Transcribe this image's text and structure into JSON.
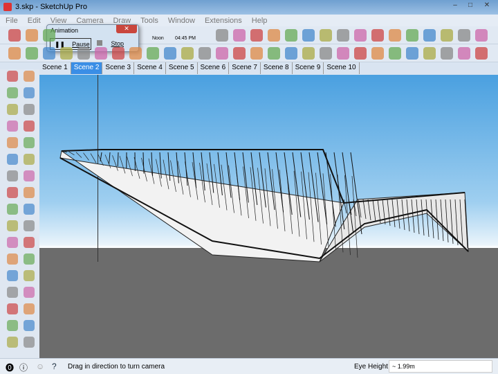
{
  "window": {
    "title": "3.skp - SketchUp Pro"
  },
  "menu": [
    "File",
    "Edit",
    "View",
    "Camera",
    "Draw",
    "Tools",
    "Window",
    "Extensions",
    "Help"
  ],
  "shadow": {
    "noon_label": "Noon",
    "time_label": "04:45 PM"
  },
  "animation_dialog": {
    "title": "Animation",
    "pause_label": "Pause",
    "stop_label": "Stop"
  },
  "scenes": [
    "Scene 1",
    "Scene 2",
    "Scene 3",
    "Scene 4",
    "Scene 5",
    "Scene 6",
    "Scene 7",
    "Scene 8",
    "Scene 9",
    "Scene 10"
  ],
  "selected_scene": 1,
  "status": {
    "message": "Drag in direction to turn camera",
    "measure_label": "Eye Height",
    "measure_value": "~ 1.99m"
  }
}
